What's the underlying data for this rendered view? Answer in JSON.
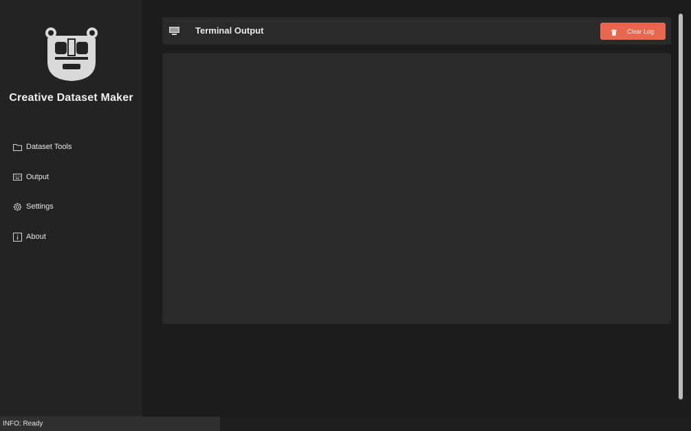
{
  "app": {
    "title": "Creative Dataset Maker",
    "logo_icon": "robot-icon"
  },
  "sidebar": {
    "items": [
      {
        "label": "Dataset Tools",
        "icon": "folder-icon"
      },
      {
        "label": "Output",
        "icon": "keyboard-icon"
      },
      {
        "label": "Settings",
        "icon": "gear-icon"
      },
      {
        "label": "About",
        "icon": "info-icon"
      }
    ]
  },
  "header": {
    "title": "Terminal Output",
    "icon": "monitor-icon",
    "clear_button": {
      "label": "Clear Log",
      "icon": "trash-icon",
      "color": "#e8684f"
    }
  },
  "terminal": {
    "content": ""
  },
  "status": {
    "text": "INFO: Ready"
  }
}
